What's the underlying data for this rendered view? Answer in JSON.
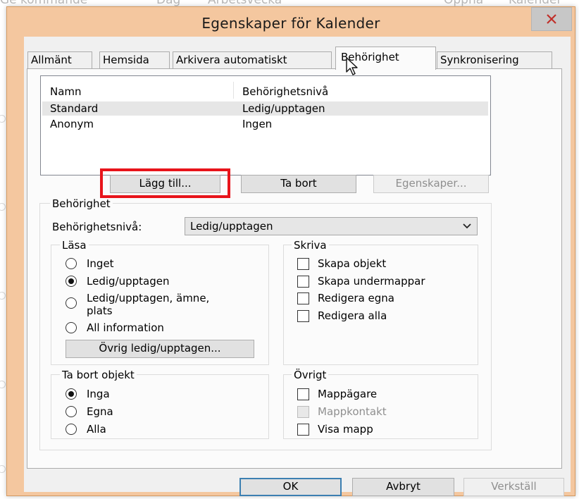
{
  "background": {
    "items": [
      "Ge kommande",
      "Dag",
      "Arbetsvecka",
      "Öppna",
      "Kalender"
    ]
  },
  "dialog": {
    "title": "Egenskaper för Kalender"
  },
  "tabs": [
    {
      "label": "Allmänt",
      "active": false
    },
    {
      "label": "Hemsida",
      "active": false
    },
    {
      "label": "Arkivera automatiskt",
      "active": false
    },
    {
      "label": "Behörighet",
      "active": true
    },
    {
      "label": "Synkronisering",
      "active": false
    }
  ],
  "userlist": {
    "headers": [
      "Namn",
      "Behörighetsnivå"
    ],
    "rows": [
      {
        "name": "Standard",
        "level": "Ledig/upptagen",
        "selected": true
      },
      {
        "name": "Anonym",
        "level": "Ingen",
        "selected": false
      }
    ]
  },
  "list_buttons": {
    "add": "Lägg till...",
    "remove": "Ta bort",
    "properties": "Egenskaper..."
  },
  "permission": {
    "group_label": "Behörighet",
    "level_label": "Behörighetsnivå:",
    "level_value": "Ledig/upptagen",
    "read": {
      "label": "Läsa",
      "options": [
        "Inget",
        "Ledig/upptagen",
        "Ledig/upptagen, ämne,",
        "plats",
        "All information"
      ],
      "selected": "Ledig/upptagen",
      "other_button": "Övrig ledig/upptagen..."
    },
    "write": {
      "label": "Skriva",
      "options": [
        "Skapa objekt",
        "Skapa undermappar",
        "Redigera egna",
        "Redigera alla"
      ]
    },
    "delete": {
      "label": "Ta bort objekt",
      "options": [
        "Inga",
        "Egna",
        "Alla"
      ],
      "selected": "Inga"
    },
    "other": {
      "label": "Övrigt",
      "options": [
        "Mappägare",
        "Mappkontakt",
        "Visa mapp"
      ]
    }
  },
  "footer": {
    "ok": "OK",
    "cancel": "Avbryt",
    "apply": "Verkställ"
  },
  "colors": {
    "highlight": "#e8141b",
    "title_bar": "#f4c79f",
    "close_button": "#c7c7c7"
  },
  "icons": {
    "close": "close-icon",
    "dropdown": "chevron-down-icon",
    "cursor": "mouse-pointer-icon"
  }
}
